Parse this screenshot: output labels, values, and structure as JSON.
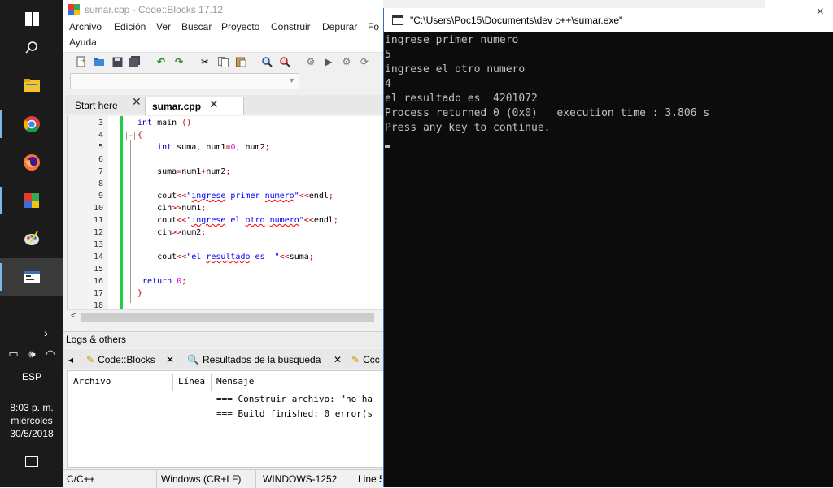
{
  "taskbar": {
    "tray_language": "ESP",
    "clock_time": "8:03 p. m.",
    "clock_day": "miércoles",
    "clock_date": "30/5/2018"
  },
  "codeblocks": {
    "title": "sumar.cpp - Code::Blocks 17.12",
    "menu": [
      "Archivo",
      "Edición",
      "Ver",
      "Buscar",
      "Proyecto",
      "Construir",
      "Depurar",
      "Fo",
      "Ayuda"
    ],
    "tabs": [
      {
        "label": "Start here"
      },
      {
        "label": "sumar.cpp"
      }
    ],
    "line_numbers": [
      "3",
      "4",
      "5",
      "6",
      "7",
      "8",
      "9",
      "10",
      "11",
      "12",
      "13",
      "14",
      "15",
      "16",
      "17",
      "18"
    ],
    "logs_header": "Logs & others",
    "log_tabs": [
      "Code::Blocks",
      "Resultados de la búsqueda",
      "Ccc"
    ],
    "log_columns": [
      "Archivo",
      "Línea",
      "Mensaje"
    ],
    "log_rows": [
      "=== Construir archivo: \"no ha",
      "=== Build finished: 0 error(s"
    ],
    "status": {
      "language": "C/C++",
      "eol": "Windows (CR+LF)",
      "encoding": "WINDOWS-1252",
      "line": "Line 5"
    }
  },
  "console": {
    "title": "\"C:\\Users\\Poc15\\Documents\\dev c++\\sumar.exe\"",
    "lines": [
      "ingrese primer numero",
      "5",
      "ingrese el otro numero",
      "4",
      "el resultado es  4201072",
      "Process returned 0 (0x0)   execution time : 3.806 s",
      "Press any key to continue."
    ]
  }
}
